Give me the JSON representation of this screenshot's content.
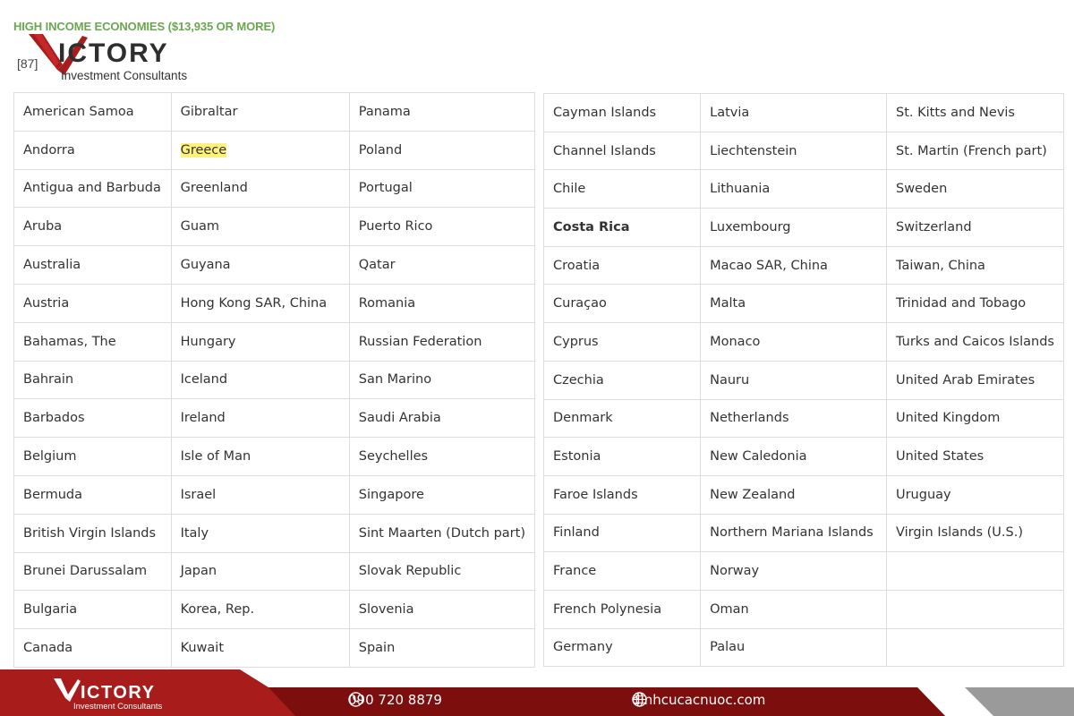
{
  "heading": "HIGH INCOME ECONOMIES ($13,935 OR MORE)",
  "count": "[87]",
  "logo": {
    "word": "ICTORY",
    "sub": "Investment Consultants"
  },
  "left_table": [
    [
      "American Samoa",
      "Gibraltar",
      "Panama"
    ],
    [
      "Andorra",
      "Greece",
      "Poland"
    ],
    [
      "Antigua and Barbuda",
      "Greenland",
      "Portugal"
    ],
    [
      "Aruba",
      "Guam",
      "Puerto Rico"
    ],
    [
      "Australia",
      "Guyana",
      "Qatar"
    ],
    [
      "Austria",
      "Hong Kong SAR, China",
      "Romania"
    ],
    [
      "Bahamas, The",
      "Hungary",
      "Russian Federation"
    ],
    [
      "Bahrain",
      "Iceland",
      "San Marino"
    ],
    [
      "Barbados",
      "Ireland",
      "Saudi Arabia"
    ],
    [
      "Belgium",
      "Isle of Man",
      "Seychelles"
    ],
    [
      "Bermuda",
      "Israel",
      "Singapore"
    ],
    [
      "British Virgin Islands",
      "Italy",
      "Sint Maarten (Dutch part)"
    ],
    [
      "Brunei Darussalam",
      "Japan",
      "Slovak Republic"
    ],
    [
      "Bulgaria",
      "Korea, Rep.",
      "Slovenia"
    ],
    [
      "Canada",
      "Kuwait",
      "Spain"
    ]
  ],
  "right_table": [
    [
      "Cayman Islands",
      "Latvia",
      "St. Kitts and Nevis"
    ],
    [
      "Channel Islands",
      "Liechtenstein",
      "St. Martin (French part)"
    ],
    [
      "Chile",
      "Lithuania",
      "Sweden"
    ],
    [
      "Costa Rica",
      "Luxembourg",
      "Switzerland"
    ],
    [
      "Croatia",
      "Macao SAR, China",
      "Taiwan, China"
    ],
    [
      "Curaçao",
      "Malta",
      "Trinidad and Tobago"
    ],
    [
      "Cyprus",
      "Monaco",
      "Turks and Caicos Islands"
    ],
    [
      "Czechia",
      "Nauru",
      "United Arab Emirates"
    ],
    [
      "Denmark",
      "Netherlands",
      "United Kingdom"
    ],
    [
      "Estonia",
      "New Caledonia",
      "United States"
    ],
    [
      "Faroe Islands",
      "New Zealand",
      "Uruguay"
    ],
    [
      "Finland",
      "Northern Mariana Islands",
      "Virgin Islands (U.S.)"
    ],
    [
      "France",
      "Norway",
      ""
    ],
    [
      "French Polynesia",
      "Oman",
      ""
    ],
    [
      "Germany",
      "Palau",
      ""
    ]
  ],
  "highlighted_cell": "Greece",
  "bold_cell": "Costa Rica",
  "footer": {
    "logo_word": "ICTORY",
    "logo_sub": "Investment Consultants",
    "phone": "090 720 8879",
    "website": "dinhcucacnuoc.com",
    "phone_icon": "phone-icon",
    "web_icon": "globe-icon"
  },
  "colors": {
    "heading_green": "#6aa84f",
    "highlight": "#fff27a",
    "brand_red": "#a81c1c",
    "footer_dark_red": "#7d0e0e",
    "footer_gray": "#9a9a9a"
  }
}
